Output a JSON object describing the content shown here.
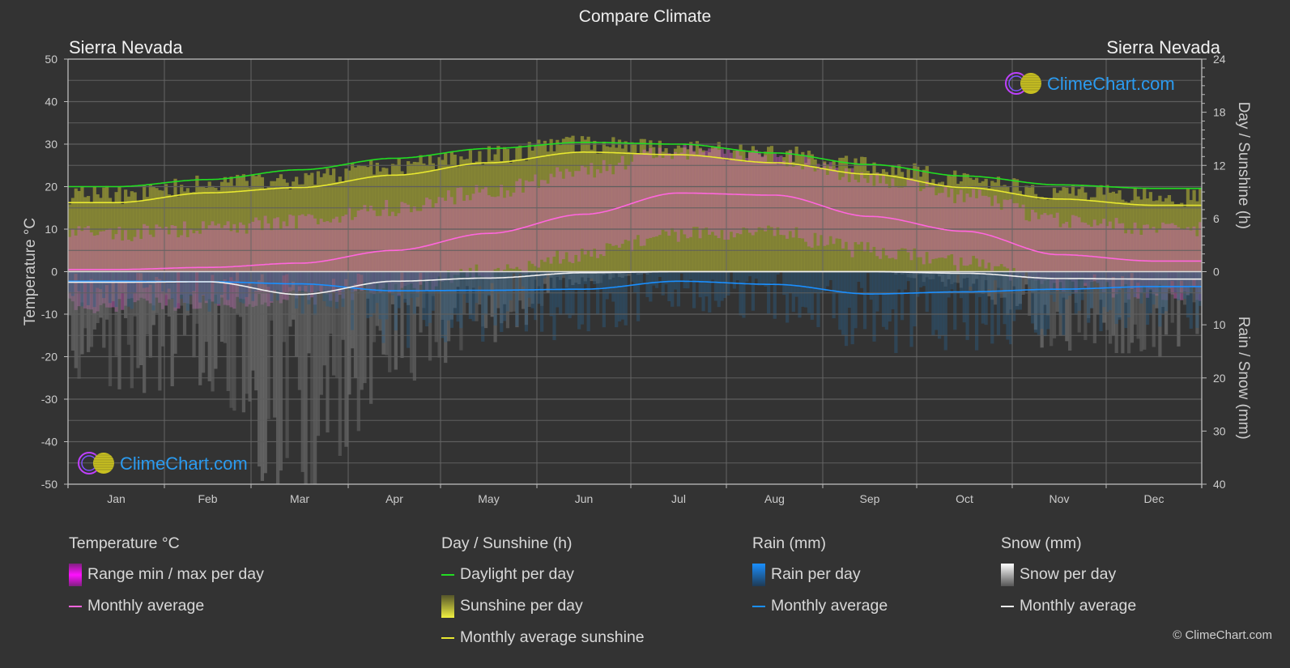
{
  "title": "Compare Climate",
  "location_left": "Sierra Nevada",
  "location_right": "Sierra Nevada",
  "watermark": "ClimeChart.com",
  "copyright": "© ClimeChart.com",
  "colors": {
    "background": "#333333",
    "grid": "#5a5a5a",
    "daylight": "#22dd22",
    "sunshine_avg": "#e8e830",
    "sunshine_fill": "#8f8f35",
    "temp_avg": "#ff66dd",
    "temp_range": "#d060c0",
    "rain_avg": "#1a8fff",
    "rain_fill": "#2a5a80",
    "snow_avg": "#f0f0f0",
    "snow_fill": "#888888",
    "brand": "#2b9bf0"
  },
  "legend": {
    "temperature": {
      "title": "Temperature °C",
      "items": [
        {
          "type": "bar",
          "label": "Range min / max per day",
          "color": "#e020e0"
        },
        {
          "type": "line",
          "label": "Monthly average",
          "color": "#ff66dd"
        }
      ]
    },
    "sunshine": {
      "title": "Day / Sunshine (h)",
      "items": [
        {
          "type": "line",
          "label": "Daylight per day",
          "color": "#22dd22"
        },
        {
          "type": "bar",
          "label": "Sunshine per day",
          "color": "#e8e830"
        },
        {
          "type": "line",
          "label": "Monthly average sunshine",
          "color": "#e8e830"
        }
      ]
    },
    "rain": {
      "title": "Rain (mm)",
      "items": [
        {
          "type": "bar",
          "label": "Rain per day",
          "color": "#1a8fff"
        },
        {
          "type": "line",
          "label": "Monthly average",
          "color": "#1a8fff"
        }
      ]
    },
    "snow": {
      "title": "Snow (mm)",
      "items": [
        {
          "type": "bar",
          "label": "Snow per day",
          "color": "#dddddd"
        },
        {
          "type": "line",
          "label": "Monthly average",
          "color": "#f0f0f0"
        }
      ]
    }
  },
  "chart_data": {
    "type": "line",
    "title": "Compare Climate",
    "categories": [
      "Jan",
      "Feb",
      "Mar",
      "Apr",
      "May",
      "Jun",
      "Jul",
      "Aug",
      "Sep",
      "Oct",
      "Nov",
      "Dec"
    ],
    "left_axis": {
      "label": "Temperature °C",
      "range": [
        -50,
        50
      ],
      "ticks": [
        50,
        40,
        30,
        20,
        10,
        0,
        -10,
        -20,
        -30,
        -40,
        -50
      ]
    },
    "right_axis_top": {
      "label": "Day / Sunshine (h)",
      "range": [
        0,
        24
      ],
      "ticks": [
        24,
        18,
        12,
        6,
        0
      ]
    },
    "right_axis_bottom": {
      "label": "Rain / Snow (mm)",
      "range": [
        0,
        40
      ],
      "ticks": [
        0,
        10,
        20,
        30,
        40
      ]
    },
    "grid": true,
    "series": [
      {
        "name": "Daylight per day",
        "axis": "hours",
        "values": [
          9.6,
          10.4,
          11.5,
          12.8,
          13.9,
          14.6,
          14.4,
          13.4,
          12.1,
          10.8,
          9.8,
          9.4
        ]
      },
      {
        "name": "Monthly average sunshine",
        "axis": "hours",
        "values": [
          7.8,
          8.9,
          9.5,
          10.9,
          12.3,
          13.5,
          13.2,
          12.3,
          11.0,
          9.5,
          8.2,
          7.5
        ]
      },
      {
        "name": "Temperature monthly average",
        "axis": "celsius",
        "values": [
          0.5,
          1.0,
          2.0,
          5.0,
          9.0,
          13.5,
          18.5,
          18.0,
          13.0,
          9.5,
          4.0,
          2.5
        ]
      },
      {
        "name": "Rain monthly average",
        "axis": "mm",
        "values": [
          1.8,
          1.9,
          2.3,
          3.6,
          3.5,
          3.3,
          1.8,
          2.4,
          4.2,
          3.8,
          3.3,
          2.8
        ]
      },
      {
        "name": "Snow monthly average",
        "axis": "mm",
        "values": [
          2.0,
          1.9,
          4.3,
          1.8,
          1.2,
          0.2,
          0.0,
          0.0,
          0.0,
          0.3,
          1.3,
          1.4
        ]
      }
    ],
    "temp_range_approx": {
      "min": [
        -8,
        -7,
        -6,
        -4,
        0,
        4,
        9,
        9,
        5,
        2,
        -3,
        -5
      ],
      "max": [
        9,
        10,
        12,
        15,
        19,
        24,
        28,
        27,
        22,
        18,
        12,
        10
      ]
    },
    "legend_position": "bottom"
  }
}
